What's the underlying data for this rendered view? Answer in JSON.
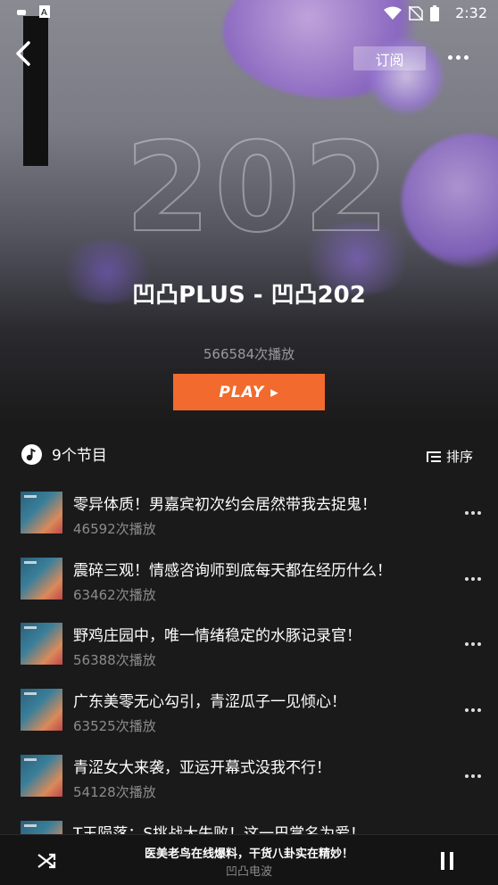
{
  "status_bar": {
    "time": "2:32"
  },
  "header": {
    "subscribe_label": "订阅"
  },
  "album": {
    "title": "凹凸PLUS - 凹凸202",
    "play_count": "566584次播放",
    "play_button_label": "PLAY ▸"
  },
  "episodes_header": {
    "count_label": "9个节目",
    "sort_label": "排序"
  },
  "episodes": [
    {
      "title": "零异体质！男嘉宾初次约会居然带我去捉鬼！",
      "plays": "46592次播放"
    },
    {
      "title": "震碎三观！情感咨询师到底每天都在经历什么！",
      "plays": "63462次播放"
    },
    {
      "title": "野鸡庄园中，唯一情绪稳定的水豚记录官！",
      "plays": "56388次播放"
    },
    {
      "title": "广东美零无心勾引，青涩瓜子一见倾心！",
      "plays": "63525次播放"
    },
    {
      "title": "青涩女大来袭，亚运开幕式没我不行！",
      "plays": "54128次播放"
    },
    {
      "title": "T王陨落：S挑战大失败！这一巴掌名为爱！",
      "plays": ""
    }
  ],
  "now_playing": {
    "title": "医美老鸟在线爆料，干货八卦实在精妙！",
    "subtitle": "凹凸电波"
  },
  "colors": {
    "accent": "#f26a2e",
    "background": "#1a1a1a"
  }
}
